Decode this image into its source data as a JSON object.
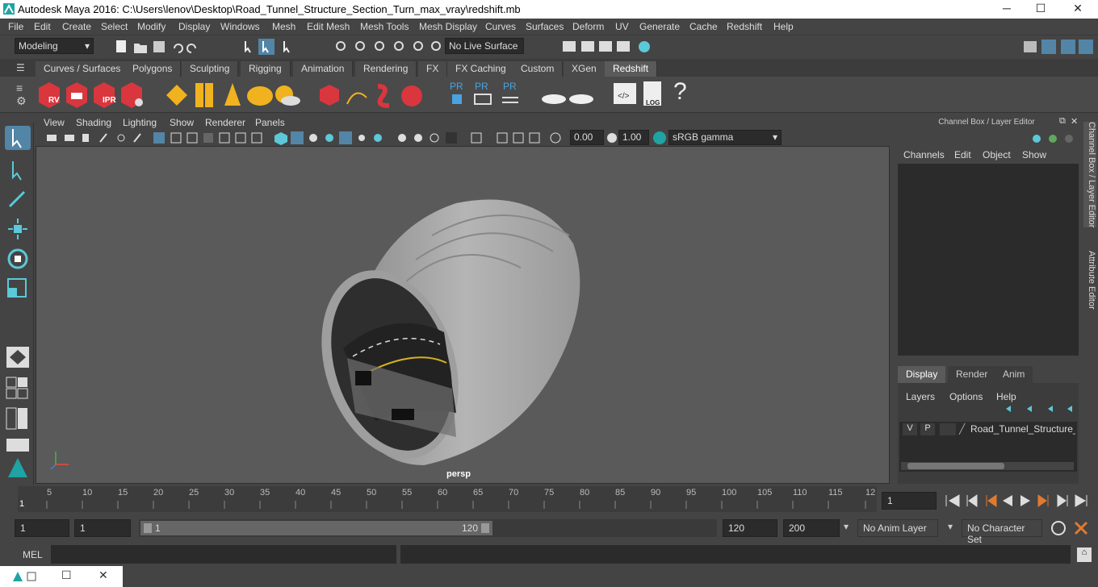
{
  "window": {
    "title": "Autodesk Maya 2016: C:\\Users\\lenov\\Desktop\\Road_Tunnel_Structure_Section_Turn_max_vray\\redshift.mb",
    "minimize": "─",
    "maximize": "☐",
    "close": "✕"
  },
  "menubar": [
    "File",
    "Edit",
    "Create",
    "Select",
    "Modify",
    "Display",
    "Windows",
    "Mesh",
    "Edit Mesh",
    "Mesh Tools",
    "Mesh Display",
    "Curves",
    "Surfaces",
    "Deform",
    "UV",
    "Generate",
    "Cache",
    "Redshift",
    "Help"
  ],
  "statusline": {
    "mode": "Modeling",
    "live_surface": "No Live Surface"
  },
  "shelf_tabs": [
    "Curves / Surfaces",
    "Polygons",
    "Sculpting",
    "Rigging",
    "Animation",
    "Rendering",
    "FX",
    "FX Caching",
    "Custom",
    "XGen",
    "Redshift"
  ],
  "active_shelf": "Redshift",
  "shelf_labels": {
    "rv": "RV",
    "ipr": "IPR",
    "pr1": "PR",
    "pr2": "PR",
    "pr3": "PR",
    "log": "LOG",
    "help": "?"
  },
  "panel_menu": [
    "View",
    "Shading",
    "Lighting",
    "Show",
    "Renderer",
    "Panels"
  ],
  "panel_tools": {
    "exposure": "0.00",
    "gamma": "1.00",
    "colorspace": "sRGB gamma"
  },
  "viewport": {
    "camera": "persp"
  },
  "right_panel": {
    "header": "Channel Box / Layer Editor",
    "menu": [
      "Channels",
      "Edit",
      "Object",
      "Show"
    ],
    "layer_tabs": [
      "Display",
      "Render",
      "Anim"
    ],
    "active_layer_tab": "Display",
    "layer_menu": [
      "Layers",
      "Options",
      "Help"
    ],
    "layer": {
      "v": "V",
      "p": "P",
      "name": "Road_Tunnel_Structure_"
    }
  },
  "side_tabs": [
    "Channel Box / Layer Editor",
    "Attribute Editor"
  ],
  "timeline": {
    "ticks": [
      "5",
      "10",
      "15",
      "20",
      "25",
      "30",
      "35",
      "40",
      "45",
      "50",
      "55",
      "60",
      "65",
      "70",
      "75",
      "80",
      "85",
      "90",
      "95",
      "100",
      "105",
      "110",
      "115",
      "12"
    ],
    "start_marker": "1",
    "current_frame": "1"
  },
  "range": {
    "start": "1",
    "playback_start": "1",
    "slider_start": "1",
    "slider_end": "120",
    "playback_end": "120",
    "end": "200",
    "anim_layer": "No Anim Layer",
    "char_set": "No Character Set"
  },
  "cmdline": {
    "label": "MEL"
  },
  "colors": {
    "accent": "#5285a6",
    "redshift_red": "#d9363e",
    "maya_teal": "#1fa3a3"
  }
}
